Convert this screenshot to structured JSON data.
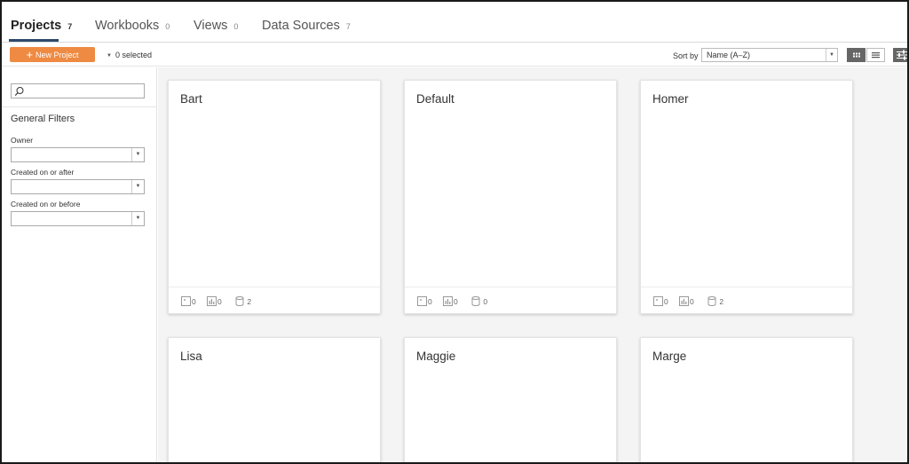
{
  "tabs": [
    {
      "label": "Projects",
      "count": "7"
    },
    {
      "label": "Workbooks",
      "count": "0"
    },
    {
      "label": "Views",
      "count": "0"
    },
    {
      "label": "Data Sources",
      "count": "7"
    }
  ],
  "toolbar": {
    "new_project_label": "New Project",
    "selected_label": "0 selected",
    "sort_by_label": "Sort by",
    "sort_value": "Name (A–Z)"
  },
  "sidebar": {
    "search_placeholder": "",
    "general_filters_title": "General Filters",
    "filters": [
      {
        "label": "Owner",
        "value": ""
      },
      {
        "label": "Created on or after",
        "value": ""
      },
      {
        "label": "Created on or before",
        "value": ""
      }
    ]
  },
  "cards": [
    {
      "name": "Bart",
      "workbooks": "0",
      "views": "0",
      "datasources": "2"
    },
    {
      "name": "Default",
      "workbooks": "0",
      "views": "0",
      "datasources": "0"
    },
    {
      "name": "Homer",
      "workbooks": "0",
      "views": "0",
      "datasources": "2"
    },
    {
      "name": "Lisa",
      "workbooks": "",
      "views": "",
      "datasources": ""
    },
    {
      "name": "Maggie",
      "workbooks": "",
      "views": "",
      "datasources": ""
    },
    {
      "name": "Marge",
      "workbooks": "",
      "views": "",
      "datasources": ""
    }
  ],
  "icons": {
    "new_project": "plus-icon",
    "selection": "caret-down-icon",
    "search": "magnifier-icon",
    "grid_view": "grid-icon",
    "list_view": "list-icon",
    "filters": "sliders-icon",
    "workbook_stat": "workbook-icon",
    "view_stat": "bar-chart-icon",
    "datasource_stat": "database-cylinder-icon"
  },
  "colors": {
    "accent": "#ee8a42",
    "tab_underline": "#2d4a6b",
    "content_background": "#f4f4f4"
  }
}
